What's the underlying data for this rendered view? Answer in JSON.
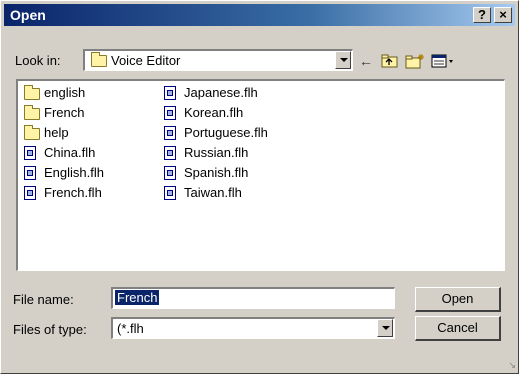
{
  "window": {
    "title": "Open",
    "help_glyph": "?",
    "close_glyph": "×"
  },
  "lookin": {
    "label": "Look in:",
    "value": "Voice Editor",
    "icon": "folder-icon"
  },
  "toolbar": {
    "back_icon": "back-arrow-icon",
    "up_icon": "up-folder-icon",
    "new_folder_icon": "new-folder-icon",
    "view_icon": "view-menu-icon"
  },
  "files": {
    "col1": [
      {
        "name": "english",
        "type": "folder"
      },
      {
        "name": "French",
        "type": "folder"
      },
      {
        "name": "help",
        "type": "folder"
      },
      {
        "name": "China.flh",
        "type": "file"
      },
      {
        "name": "English.flh",
        "type": "file"
      },
      {
        "name": "French.flh",
        "type": "file"
      }
    ],
    "col2": [
      {
        "name": "Japanese.flh",
        "type": "file"
      },
      {
        "name": "Korean.flh",
        "type": "file"
      },
      {
        "name": "Portuguese.flh",
        "type": "file"
      },
      {
        "name": "Russian.flh",
        "type": "file"
      },
      {
        "name": "Spanish.flh",
        "type": "file"
      },
      {
        "name": "Taiwan.flh",
        "type": "file"
      }
    ]
  },
  "filename": {
    "label": "File name:",
    "value": "French"
  },
  "filetype": {
    "label": "Files of type:",
    "value": "(*.flh"
  },
  "buttons": {
    "open": "Open",
    "cancel": "Cancel"
  }
}
